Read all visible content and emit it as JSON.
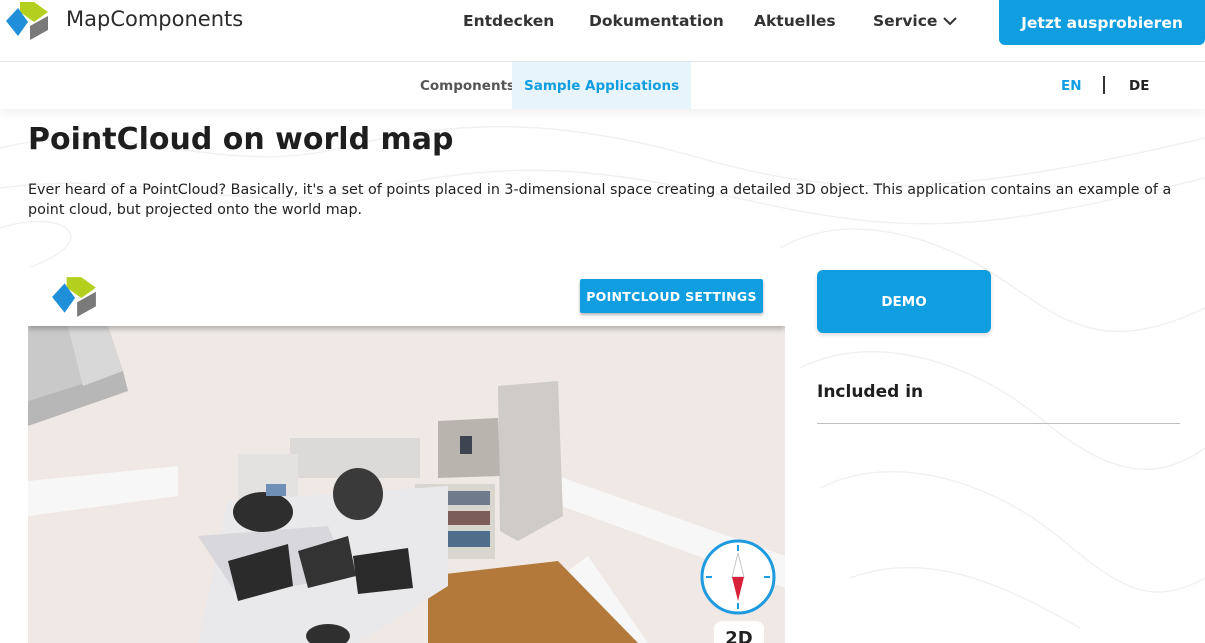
{
  "brand": {
    "name": "MapComponents",
    "colors": {
      "blue": "#1e8fd8",
      "green": "#b5cf1f",
      "gray": "#7a7a7a"
    }
  },
  "header": {
    "nav": [
      "Entdecken",
      "Dokumentation",
      "Aktuelles",
      "Service"
    ],
    "service_icon": "chevron-down-icon",
    "cta_label": "Jetzt ausprobieren"
  },
  "subnav": {
    "items": [
      "Components",
      "Sample Applications"
    ],
    "active": "Sample Applications",
    "languages": [
      "EN",
      "DE"
    ],
    "active_language": "EN"
  },
  "page": {
    "title": "PointCloud on world map",
    "description": "Ever heard of a PointCloud? Basically, it's a set of points placed in 3-dimensional space creating a detailed 3D object. This application contains an example of a point cloud, but projected onto the world map."
  },
  "demo_app": {
    "settings_label": "POINTCLOUD SETTINGS",
    "compass_icon": "compass-icon",
    "view_toggle": "2D"
  },
  "sidebar": {
    "demo_label": "DEMO",
    "included_heading": "Included in"
  },
  "theme": {
    "accent": "#119ee0",
    "text": "#222222",
    "active_bg": "#e7f4fb"
  }
}
